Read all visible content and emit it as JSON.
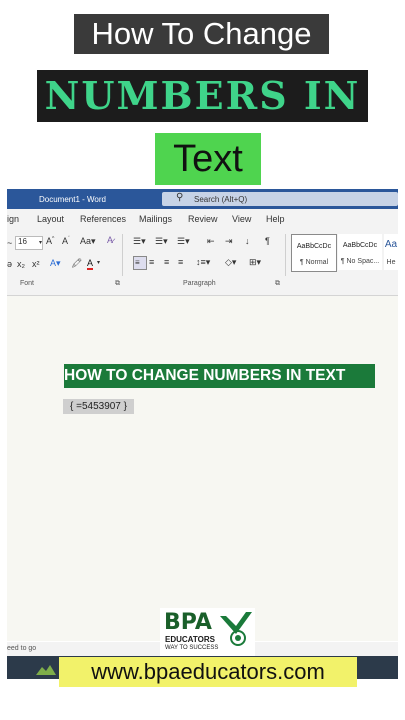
{
  "overlay": {
    "line1": "How To Change",
    "line2": "NUMBERS IN",
    "line3": "Text"
  },
  "word": {
    "window_title": "Document1 - Word",
    "search_placeholder": "Search (Alt+Q)",
    "tabs": [
      "ign",
      "Layout",
      "References",
      "Mailings",
      "Review",
      "View",
      "Help"
    ],
    "font_size": "16",
    "styles": [
      {
        "preview": "AaBbCcDc",
        "name": "¶ Normal"
      },
      {
        "preview": "AaBbCcDc",
        "name": "¶ No Spac..."
      },
      {
        "preview": "Aa",
        "name": "He"
      }
    ],
    "groups": {
      "font": "Font",
      "paragraph": "Paragraph"
    },
    "document": {
      "heading": "HOW TO CHANGE NUMBERS IN TEXT",
      "field": "{ =545390​7 }"
    },
    "status": "eed to go"
  },
  "branding": {
    "logo_main": "BPA",
    "logo_sub": "EDUCATORS",
    "logo_tagline": "WAY TO SUCCESS",
    "website": "www.bpaeducators.com"
  },
  "colors": {
    "word_blue": "#2b579a",
    "heading_green": "#1b7a3a",
    "title_green_text": "#3fd48a",
    "text_highlight_green": "#4fd44f",
    "website_yellow": "#f2f26a"
  }
}
